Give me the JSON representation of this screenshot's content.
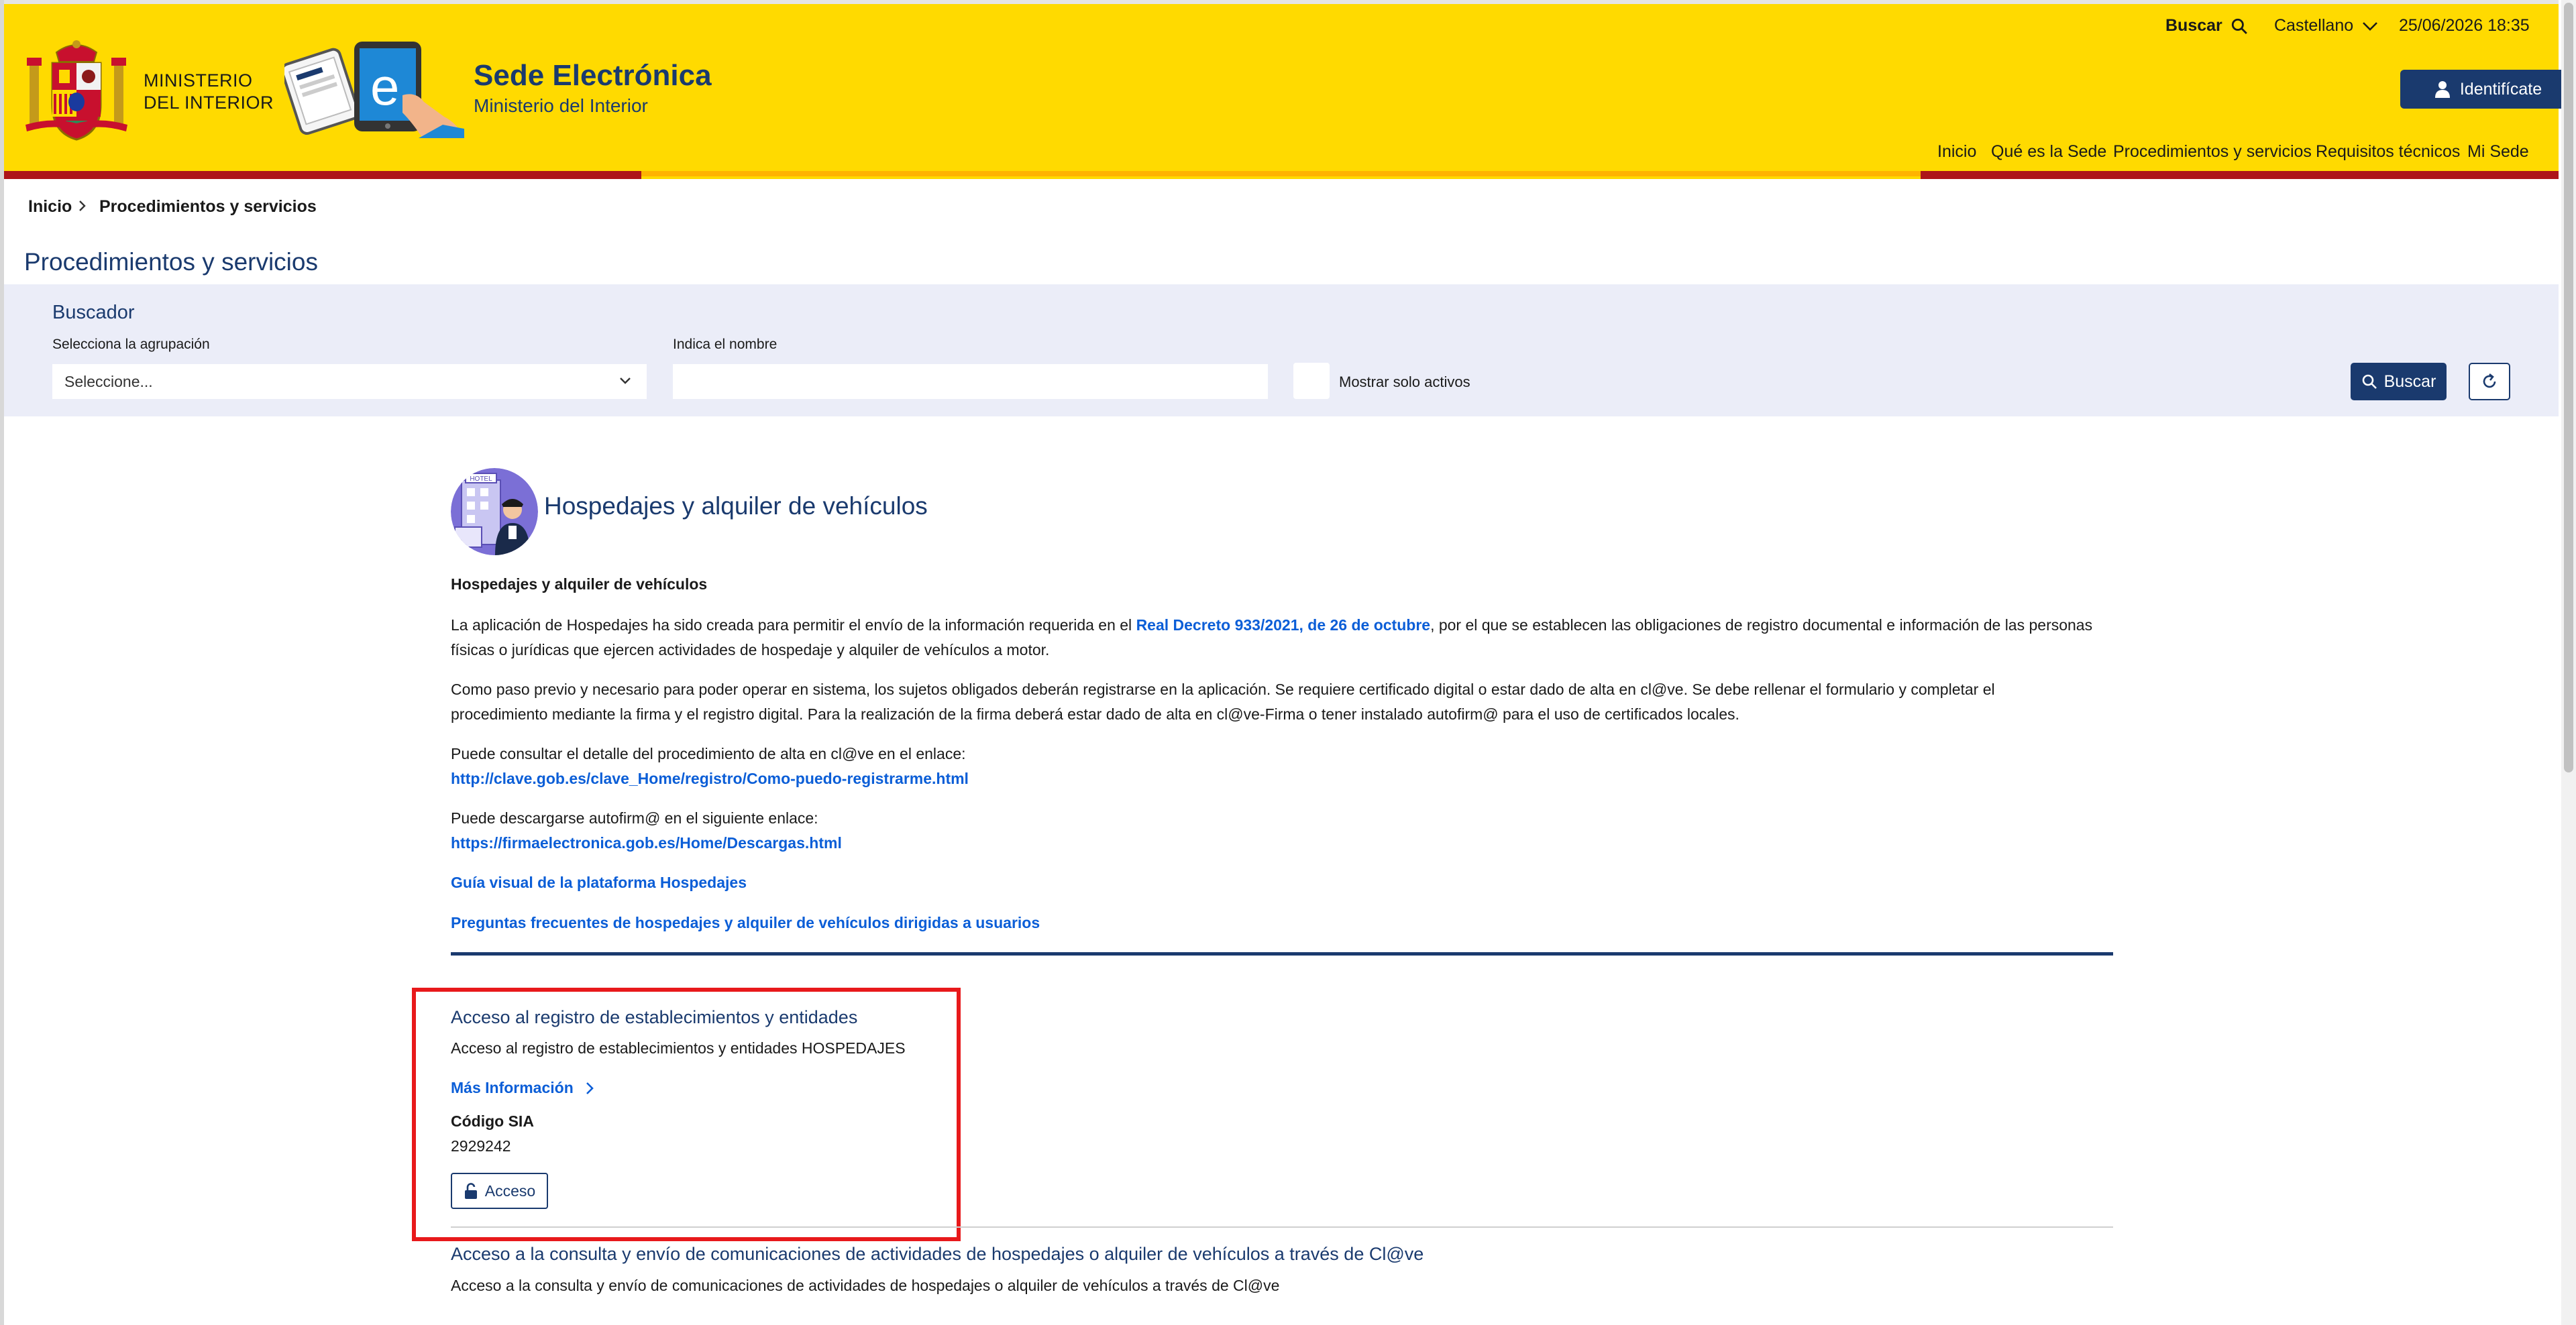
{
  "header": {
    "ministerio_line1": "MINISTERIO",
    "ministerio_line2": "DEL INTERIOR",
    "site_title": "Sede Electrónica",
    "site_subtitle": "Ministerio del Interior",
    "search_label": "Buscar",
    "language": "Castellano",
    "datetime": "25/06/2026 18:35",
    "identify_label": "Identifícate",
    "nav": [
      "Inicio",
      "Qué es la Sede",
      "Procedimientos y servicios",
      "Requisitos técnicos",
      "Mi Sede"
    ]
  },
  "breadcrumb": {
    "home": "Inicio",
    "current": "Procedimientos y servicios"
  },
  "page_title": "Procedimientos y servicios",
  "search": {
    "title": "Buscador",
    "group_label": "Selecciona la agrupación",
    "group_value": "Seleccione...",
    "name_label": "Indica el nombre",
    "name_value": "",
    "active_label": "Mostrar solo activos",
    "button_label": "Buscar"
  },
  "section": {
    "title": "Hospedajes y alquiler de vehículos",
    "heading": "Hospedajes y alquiler de vehículos",
    "p1_before": "La aplicación de Hospedajes ha sido creada para permitir el envío de la información requerida en el ",
    "p1_link": "Real Decreto 933/2021, de 26 de octubre",
    "p1_after": ", por el que se establecen las obligaciones de registro documental e información de las personas físicas o jurídicas que ejercen actividades de hospedaje y alquiler de vehículos a motor.",
    "p2": "Como paso previo y necesario para poder operar en sistema, los sujetos obligados deberán registrarse en la aplicación. Se requiere certificado digital o estar dado de alta en cl@ve. Se debe rellenar el formulario y completar el procedimiento mediante la firma y el registro digital. Para la realización de la firma deberá estar dado de alta en cl@ve-Firma o tener instalado autofirm@ para el uso de certificados locales.",
    "p3_text": "Puede consultar el detalle del procedimiento de alta en cl@ve en el enlace:",
    "p3_link": "http://clave.gob.es/clave_Home/registro/Como-puedo-registrarme.html",
    "p4_text": "Puede descargarse autofirm@ en el siguiente enlace:",
    "p4_link": "https://firmaelectronica.gob.es/Home/Descargas.html",
    "link_guide": "Guía visual de la plataforma Hospedajes",
    "link_faq": "Preguntas frecuentes de hospedajes y alquiler de vehículos dirigidas a usuarios",
    "avatar_sign": "HOTEL"
  },
  "card1": {
    "title": "Acceso al registro de establecimientos y entidades",
    "description": "Acceso al registro de establecimientos y entidades HOSPEDAJES",
    "more_info": "Más Información",
    "sia_label": "Código SIA",
    "sia_value": "2929242",
    "access_label": "Acceso"
  },
  "card2": {
    "title": "Acceso a la consulta y envío de comunicaciones de actividades de hospedajes o alquiler de vehículos a través de Cl@ve",
    "description": "Acceso a la consulta y envío de comunicaciones de actividades de hospedajes o alquiler de vehículos a través de Cl@ve"
  },
  "colors": {
    "brand_yellow": "#ffda00",
    "brand_blue": "#1a3a6e",
    "link_blue": "#0b5ed7",
    "highlight_red": "#e8191b"
  },
  "icons": [
    "coat-of-arms-icon",
    "tablet-illustration-icon",
    "search-icon",
    "chevron-down-icon",
    "user-icon",
    "refresh-icon",
    "unlock-icon",
    "chevron-right-icon"
  ]
}
